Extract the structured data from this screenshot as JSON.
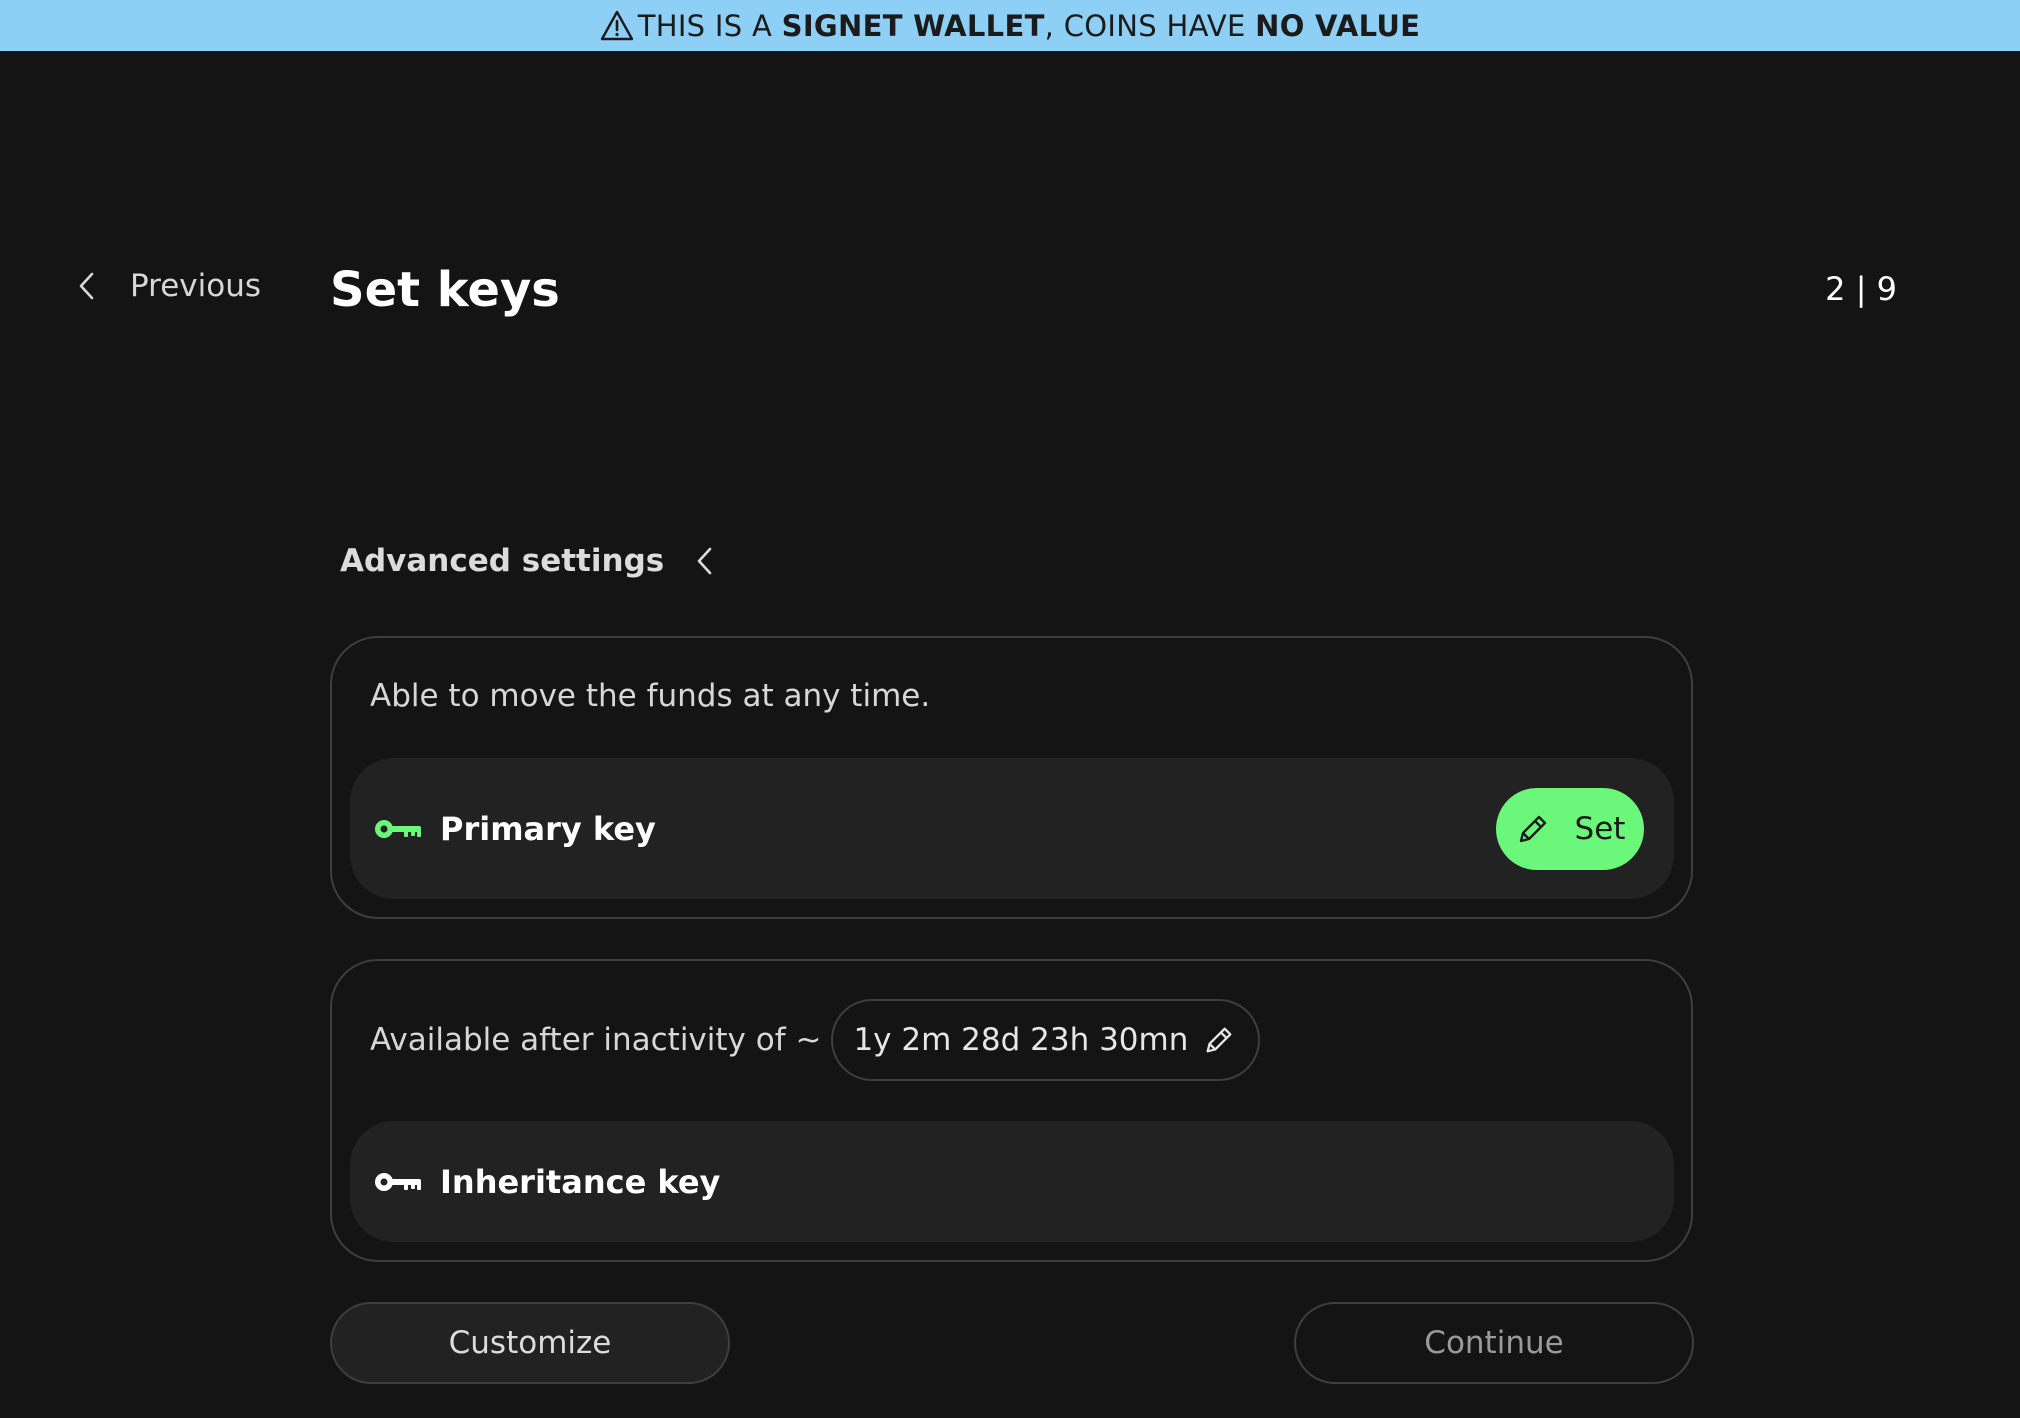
{
  "banner": {
    "text_1": "THIS IS A ",
    "strong_1": "SIGNET WALLET",
    "text_2": ", COINS HAVE ",
    "strong_2": "NO VALUE",
    "icon": "warning-icon",
    "background": "#8ecff5"
  },
  "header": {
    "previous_label": "Previous",
    "title": "Set keys",
    "step": "2 | 9"
  },
  "advanced_settings": {
    "label": "Advanced settings",
    "icon": "chevron-left-icon"
  },
  "primary_card": {
    "description": "Able to move the funds at any time.",
    "key_label": "Primary key",
    "key_icon": "key-icon",
    "key_icon_color": "#6af77a",
    "set_button_label": "Set",
    "set_button_icon": "pencil-icon",
    "set_button_color": "#6af77a"
  },
  "inheritance_card": {
    "inactivity_label": "Available after inactivity of ~",
    "inactivity_value": "1y 2m 28d 23h 30mn",
    "edit_icon": "pencil-icon",
    "key_label": "Inheritance key",
    "key_icon": "key-icon"
  },
  "footer": {
    "customize_label": "Customize",
    "continue_label": "Continue"
  }
}
